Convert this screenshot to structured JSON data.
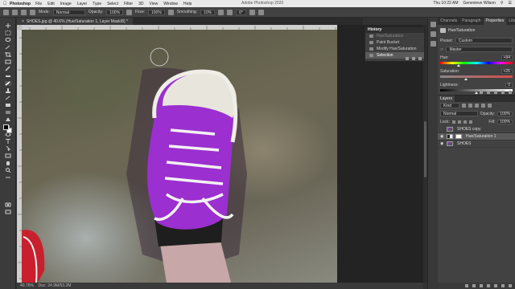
{
  "menubar": {
    "apple": "",
    "app_name": "Photoshop",
    "items": [
      "File",
      "Edit",
      "Image",
      "Layer",
      "Type",
      "Select",
      "Filter",
      "3D",
      "View",
      "Window",
      "Help"
    ],
    "window_title": "Adobe Photoshop 2020",
    "clock": "Thu 10:22 AM",
    "user": "Genevieve Wilson"
  },
  "options_bar": {
    "mode_label": "Mode:",
    "mode_value": "Normal",
    "opacity_label": "Opacity:",
    "opacity_value": "100%",
    "flow_label": "Flow:",
    "flow_value": "100%",
    "smoothing_label": "Smoothing:",
    "smoothing_value": "10%",
    "angle_value": "0°"
  },
  "document": {
    "tab_title": "SHOES.jpg @ 40.6% (Hue/Saturation 1, Layer Mask/8) *",
    "status": "40.76%",
    "status_extra": "Doc: 24.9M/53.2M"
  },
  "history": {
    "title": "History",
    "rows": [
      {
        "label": "Hue/Saturation",
        "state": "dim"
      },
      {
        "label": "Paint Bucket",
        "state": "normal"
      },
      {
        "label": "Modify Hue/Saturation Layer",
        "state": "normal"
      },
      {
        "label": "Selection",
        "state": "selected"
      }
    ]
  },
  "properties": {
    "tabs": [
      "Channels",
      "Paragraph",
      "Properties",
      "Libraries"
    ],
    "active_tab": "Properties",
    "adjustment_name": "Hue/Saturation",
    "preset_label": "Preset:",
    "preset_value": "Custom",
    "channel_value": "Master",
    "hue_label": "Hue:",
    "hue_value": "+94",
    "saturation_label": "Saturation:",
    "saturation_value": "+26",
    "lightness_label": "Lightness:",
    "lightness_value": "0"
  },
  "layers": {
    "title": "Layers",
    "kind_label": "Kind",
    "blend_mode": "Normal",
    "opacity_label": "Opacity:",
    "opacity_value": "100%",
    "lock_label": "Lock:",
    "fill_label": "Fill:",
    "fill_value": "100%",
    "rows": [
      {
        "name": "SHOES copy",
        "visible": false,
        "thumb": "photo"
      },
      {
        "name": "Hue/Saturation 1",
        "visible": true,
        "thumb": "adj",
        "selected": true
      },
      {
        "name": "SHOES",
        "visible": true,
        "thumb": "photo"
      }
    ]
  },
  "colors": {
    "shoe_purple": "#9b2fd0",
    "panel_bg": "#424242",
    "selected_row": "#595959"
  }
}
